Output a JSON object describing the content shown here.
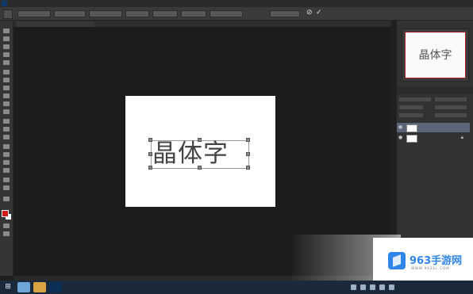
{
  "canvas": {
    "text": "晶体字"
  },
  "navigator": {
    "thumb_text": "晶体字"
  },
  "layers": [
    {
      "name": "",
      "selected": true,
      "type": "text",
      "locked": false
    },
    {
      "name": "",
      "selected": false,
      "type": "background",
      "locked": true
    }
  ],
  "watermark": {
    "title": "963手游网",
    "url": "WWW.963Sc.COM"
  },
  "options_bar": {
    "commit_icon": "check-icon",
    "cancel_icon": "cancel-icon"
  },
  "colors": {
    "foreground": "#d01a1a",
    "background": "#ffffff",
    "layer_selected": "#5a6678",
    "watermark_brand": "#2f85e8"
  }
}
